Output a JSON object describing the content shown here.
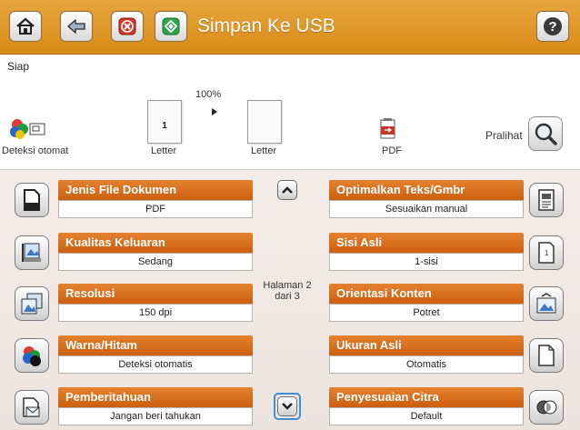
{
  "header": {
    "title": "Simpan Ke USB",
    "home_icon": "home-icon",
    "back_icon": "back-arrow-icon",
    "stop_icon": "stop-x-icon",
    "start_icon": "start-diamond-icon",
    "help_icon": "help-question-icon"
  },
  "status": {
    "text": "Siap"
  },
  "scan_preview": {
    "zoom": "100%",
    "color_mode_label": "Deteksi otomat",
    "source_page_number": "1",
    "source_size_label": "Letter",
    "output_size_label": "Letter",
    "format_label": "PDF",
    "preview_label": "Pralihat"
  },
  "settings": {
    "left": [
      {
        "title": "Jenis File Dokumen",
        "value": "PDF",
        "icon": "document-file-icon"
      },
      {
        "title": "Kualitas Keluaran",
        "value": "Sedang",
        "icon": "output-quality-icon"
      },
      {
        "title": "Resolusi",
        "value": "150 dpi",
        "icon": "resolution-icon"
      },
      {
        "title": "Warna/Hitam",
        "value": "Deteksi otomatis",
        "icon": "color-black-icon"
      },
      {
        "title": "Pemberitahuan",
        "value": "Jangan beri tahukan",
        "icon": "notification-icon"
      }
    ],
    "right": [
      {
        "title": "Optimalkan Teks/Gmbr",
        "value": "Sesuaikan manual",
        "icon": "optimize-text-image-icon"
      },
      {
        "title": "Sisi Asli",
        "value": "1-sisi",
        "icon": "original-sides-icon"
      },
      {
        "title": "Orientasi Konten",
        "value": "Potret",
        "icon": "content-orientation-icon"
      },
      {
        "title": "Ukuran Asli",
        "value": "Otomatis",
        "icon": "original-size-icon"
      },
      {
        "title": "Penyesuaian Citra",
        "value": "Default",
        "icon": "image-adjustment-icon"
      }
    ]
  },
  "pagination": {
    "line1": "Halaman 2",
    "line2": "dari 3"
  },
  "colors": {
    "header_orange": "#d98a18",
    "setting_orange": "#cc5f0f",
    "panel_bg": "#efe7e2",
    "selected_border": "#3d8fd6"
  }
}
